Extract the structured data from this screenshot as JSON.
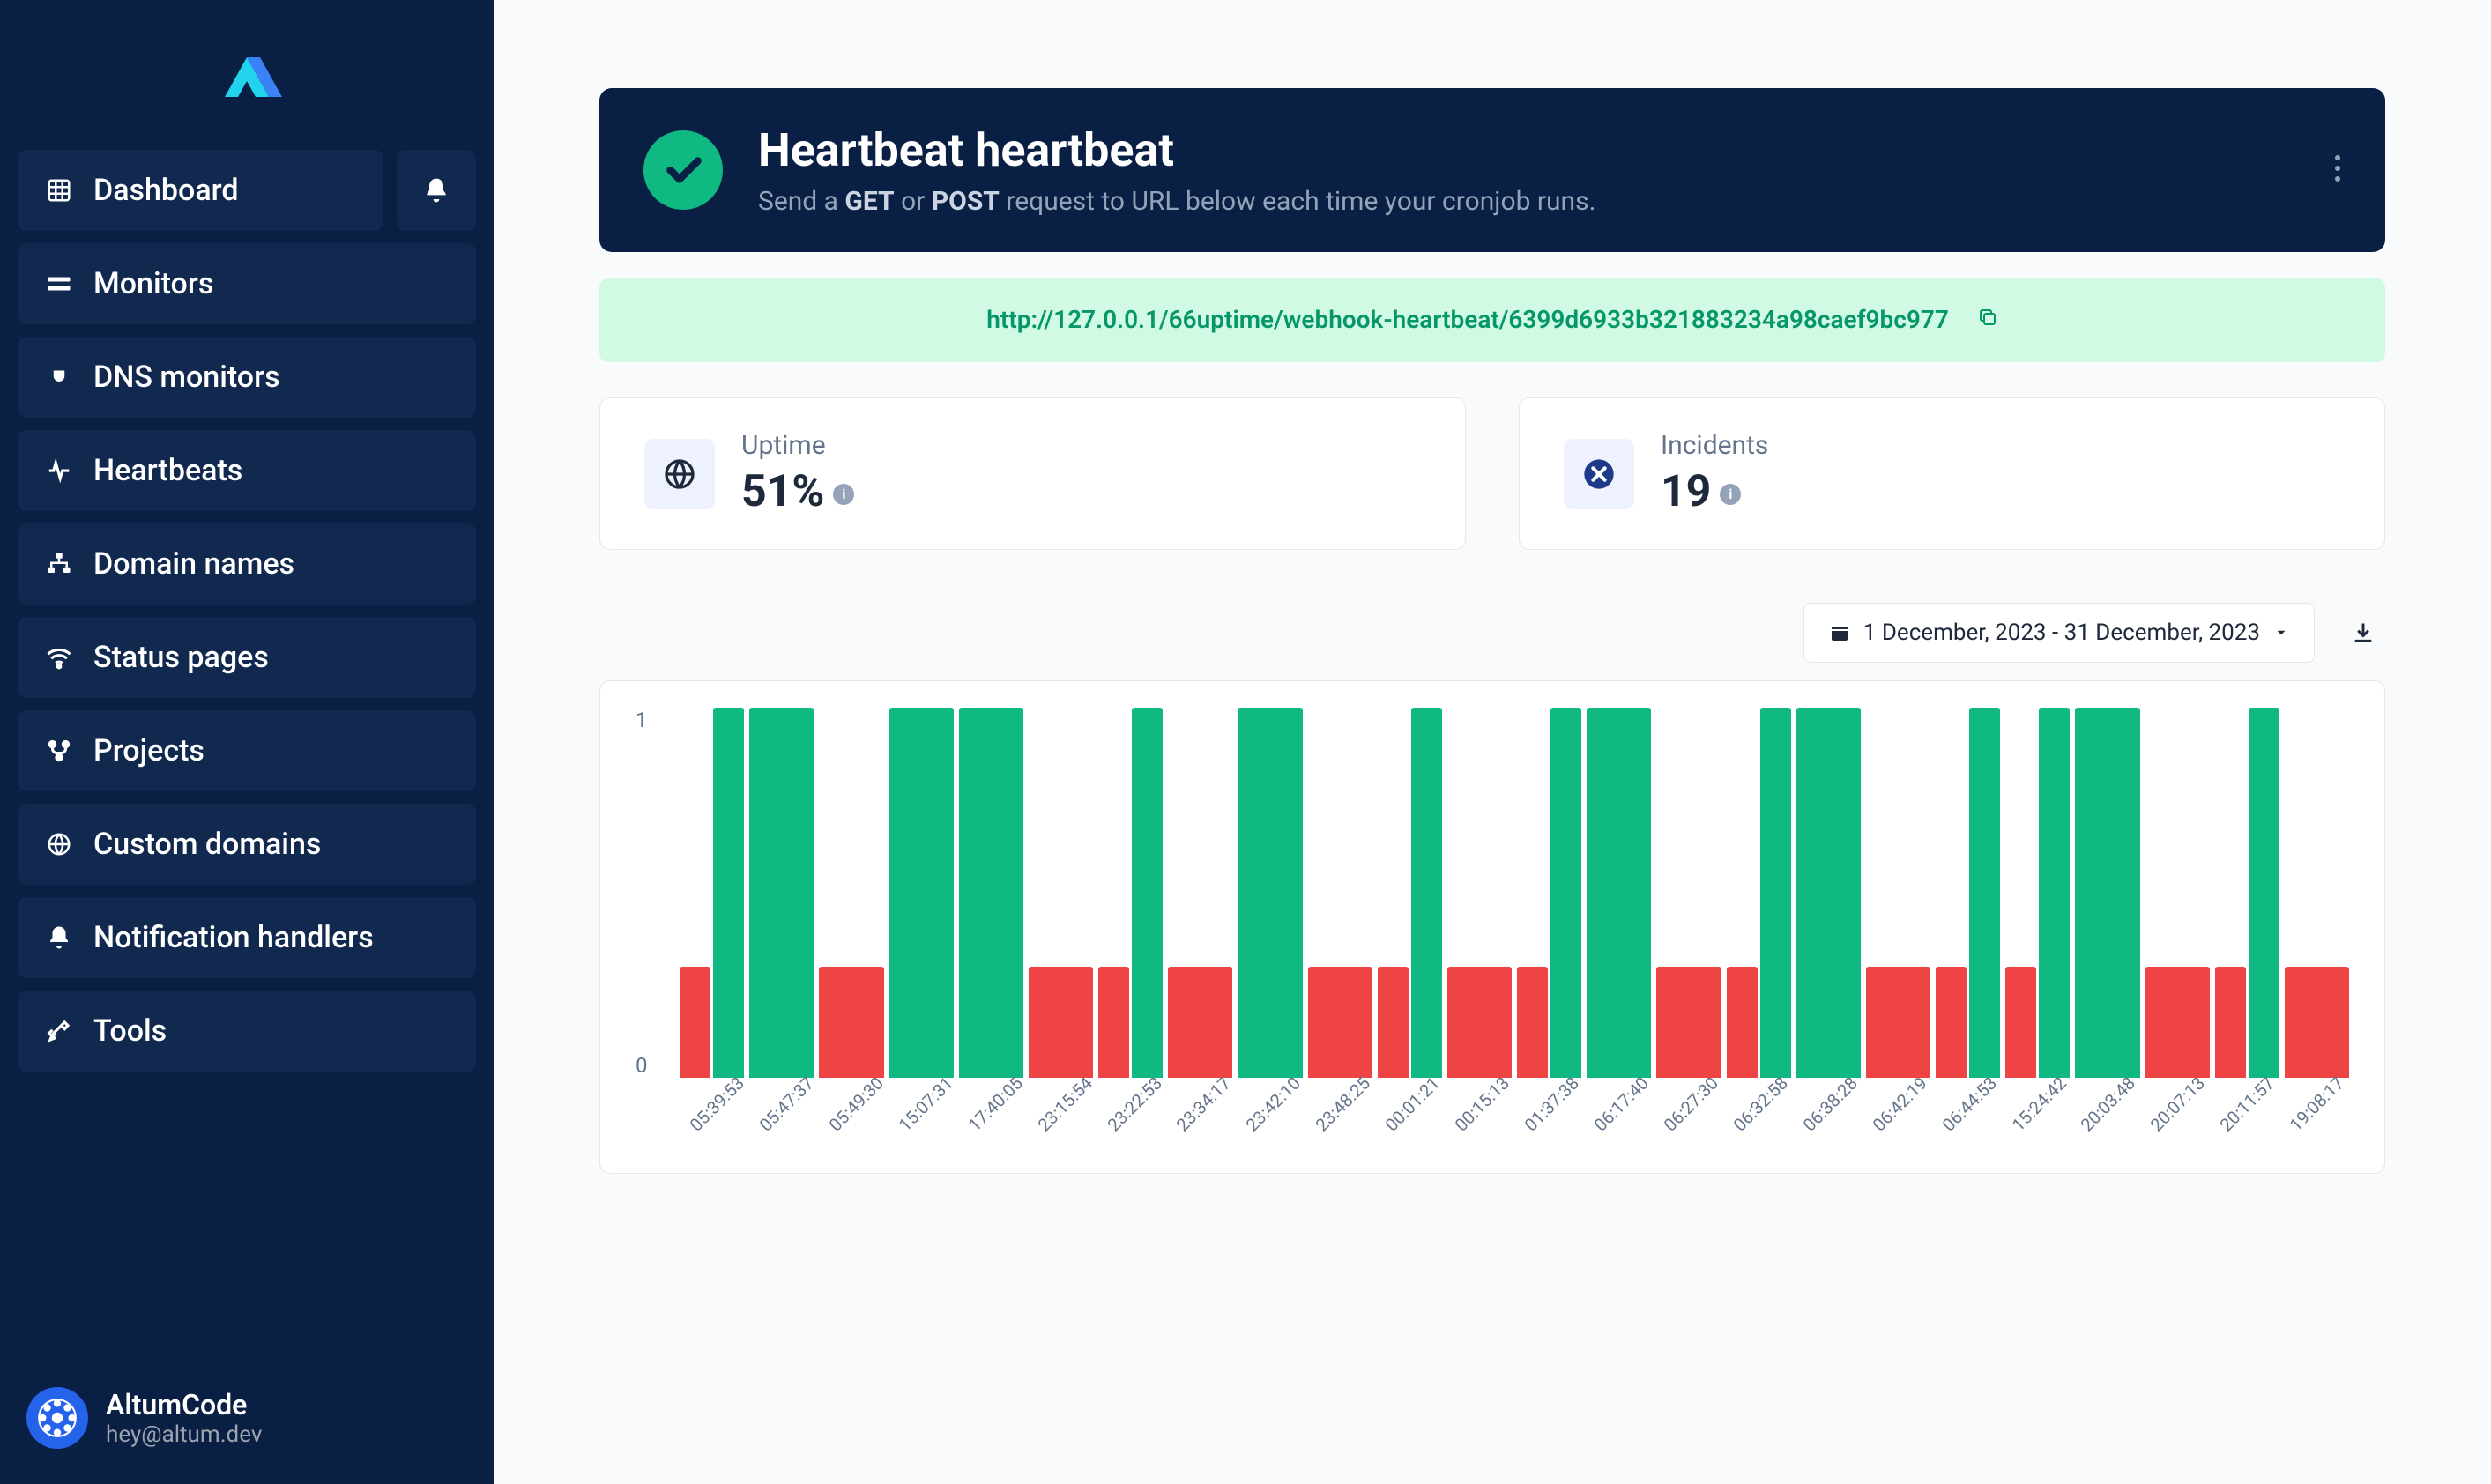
{
  "sidebar": {
    "items": [
      {
        "icon": "grid",
        "label": "Dashboard"
      },
      {
        "icon": "monitor",
        "label": "Monitors"
      },
      {
        "icon": "plug",
        "label": "DNS monitors"
      },
      {
        "icon": "pulse",
        "label": "Heartbeats"
      },
      {
        "icon": "sitemap",
        "label": "Domain names"
      },
      {
        "icon": "wifi",
        "label": "Status pages"
      },
      {
        "icon": "branch",
        "label": "Projects"
      },
      {
        "icon": "globe",
        "label": "Custom domains"
      },
      {
        "icon": "bell",
        "label": "Notification handlers"
      },
      {
        "icon": "tools",
        "label": "Tools"
      }
    ]
  },
  "user": {
    "name": "AltumCode",
    "email": "hey@altum.dev"
  },
  "header": {
    "title": "Heartbeat heartbeat",
    "sub_pre": "Send a ",
    "sub_m1": "GET",
    "sub_mid": " or ",
    "sub_m2": "POST",
    "sub_post": " request to URL below each time your cronjob runs."
  },
  "webhook_url": "http://127.0.0.1/66uptime/webhook-heartbeat/6399d6933b321883234a98caef9bc977",
  "stats": {
    "uptime_label": "Uptime",
    "uptime_value": "51%",
    "incidents_label": "Incidents",
    "incidents_value": "19"
  },
  "date_range": "1 December, 2023 - 31 December, 2023",
  "chart_data": {
    "type": "bar",
    "ylabel": "",
    "ylim": [
      0,
      1
    ],
    "y_ticks": [
      "1",
      "0"
    ],
    "categories": [
      "05:39:53",
      "05:47:37",
      "05:49:30",
      "15:07:31",
      "17:40:05",
      "23:15:54",
      "23:22:53",
      "23:34:17",
      "23:42:10",
      "23:48:25",
      "00:01:21",
      "00:15:13",
      "01:37:38",
      "06:17:40",
      "06:27:30",
      "06:32:58",
      "06:38:28",
      "06:42:19",
      "06:44:53",
      "15:24:42",
      "20:03:48",
      "20:07:13",
      "20:11:57",
      "19:08:17"
    ],
    "series": [
      {
        "name": "red",
        "color": "#ef4444",
        "values": [
          0.3,
          0,
          0.3,
          0,
          0,
          0.3,
          0.3,
          0.3,
          0,
          0.3,
          0.3,
          0.3,
          0.3,
          0,
          0.3,
          0.3,
          0,
          0.3,
          0.3,
          0.3,
          0,
          0.3,
          0.3,
          0.3
        ]
      },
      {
        "name": "green",
        "color": "#10b981",
        "values": [
          1,
          1,
          0,
          1,
          1,
          0,
          1,
          0,
          1,
          0,
          1,
          0,
          1,
          1,
          0,
          1,
          1,
          0,
          1,
          1,
          1,
          0,
          1,
          0
        ]
      }
    ]
  }
}
